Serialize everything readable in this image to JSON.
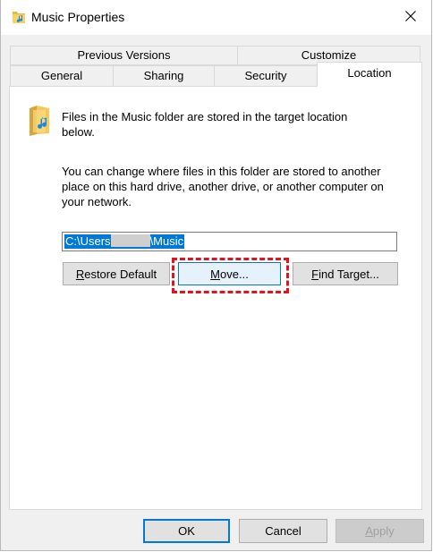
{
  "window": {
    "title": "Music Properties",
    "close_icon": "close-icon",
    "title_icon": "music-folder-icon"
  },
  "tabs": {
    "row1": [
      {
        "label": "Previous Versions"
      },
      {
        "label": "Customize"
      }
    ],
    "row2": [
      {
        "label": "General"
      },
      {
        "label": "Sharing"
      },
      {
        "label": "Security"
      },
      {
        "label": "Location",
        "active": true
      }
    ]
  },
  "location": {
    "info": "Files in the Music folder are stored in the target location below.",
    "description": "You can change where files in this folder are stored to another place on this hard drive, another drive, or another computer on your network.",
    "path_prefix": "C:\\Users",
    "path_suffix": "\\Music",
    "buttons": {
      "restore_first": "R",
      "restore_rest": "estore Default",
      "move_first": "M",
      "move_rest": "ove...",
      "find_first": "F",
      "find_rest": "ind Target..."
    }
  },
  "footer": {
    "ok": "OK",
    "cancel": "Cancel",
    "apply_first": "A",
    "apply_rest": "pply"
  },
  "colors": {
    "accent": "#0078d7",
    "highlight": "#e0141e"
  }
}
